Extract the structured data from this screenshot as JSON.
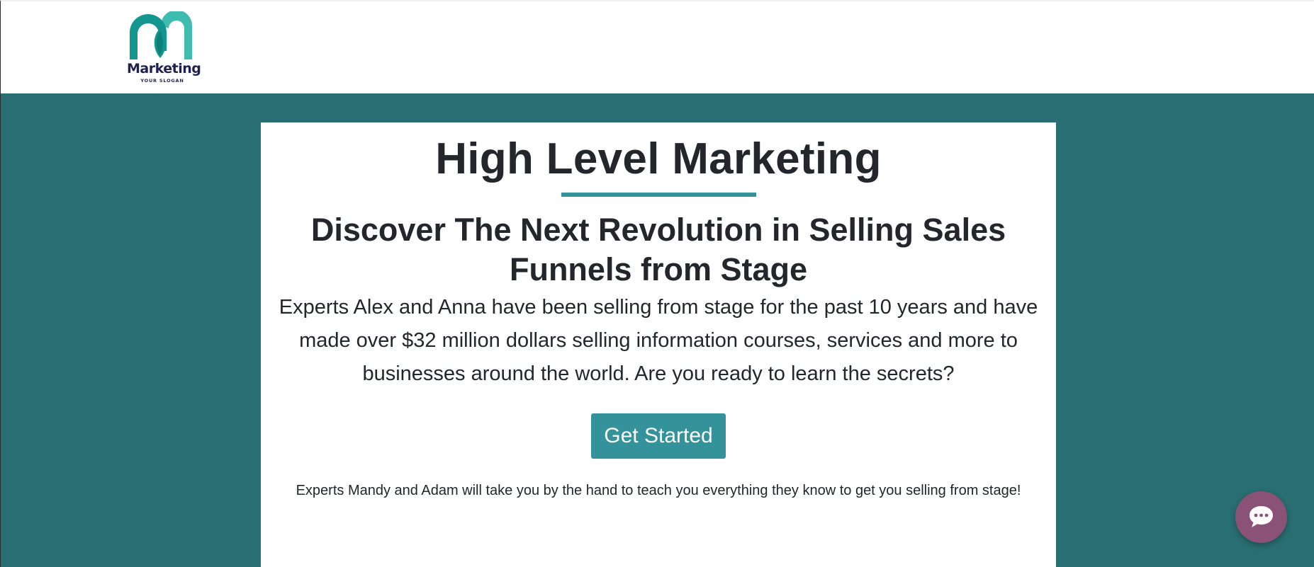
{
  "header": {
    "logo": {
      "wordmark": "Marketing",
      "slogan": "YOUR SLOGAN",
      "icon": "marketing-logo-icon",
      "colors": {
        "primary": "#13968f",
        "secondary": "#3ebcb0",
        "text": "#1e2150"
      }
    }
  },
  "hero": {
    "background_color": "#296e72",
    "card": {
      "headline": "High Level Marketing",
      "accent_color": "#34929a",
      "subheadline": {
        "part1": "Discover The Next Revolution in Selling ",
        "bold": "Sales Funnels",
        "part2": " from Stage"
      },
      "body": "Experts Alex and Anna have been selling from stage for the past 10 years and have made over $32 million dollars selling information courses, services and more to businesses around the world. Are you ready to learn the secrets?",
      "cta_label": "Get Started",
      "footnote": "Experts Mandy and Adam will take you by the hand to teach you everything they know to get you selling from stage!"
    }
  },
  "chat_widget": {
    "icon": "chat-bubble-icon",
    "color": "#8a5277"
  }
}
